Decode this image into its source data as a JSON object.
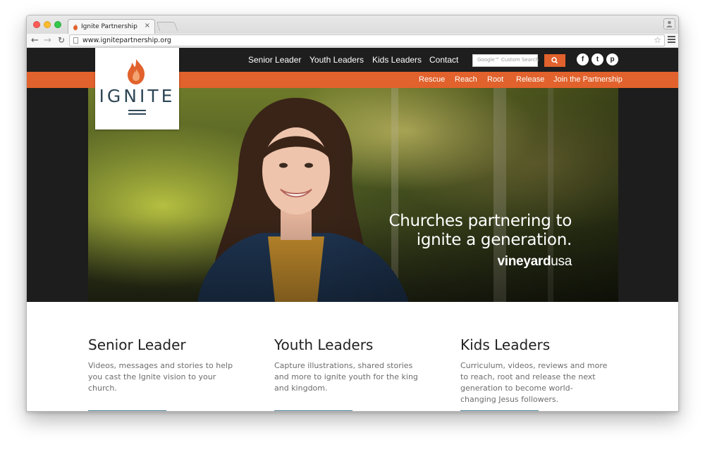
{
  "browser": {
    "tab_title": "Ignite Partnership",
    "tab_close": "×",
    "url": "www.ignitepartnership.org"
  },
  "site": {
    "logo_text": "IGNITE",
    "main_nav": [
      "Senior Leader",
      "Youth Leaders",
      "Kids Leaders",
      "Contact"
    ],
    "search_placeholder": "Google™ Custom Search",
    "social": [
      "f",
      "t",
      "p"
    ],
    "sub_nav": [
      "Rescue",
      "Reach",
      "Root",
      "Release",
      "Join the Partnership"
    ],
    "hero": {
      "headline_line1": "Churches partnering to",
      "headline_line2": "ignite a generation.",
      "brand_bold": "vineyard",
      "brand_light": "usa"
    },
    "columns": [
      {
        "title": "Senior Leader",
        "text": "Videos, messages and stories to help you cast the Ignite vision to your church."
      },
      {
        "title": "Youth Leaders",
        "text": "Capture illustrations, shared stories and more to ignite youth for the king and kingdom."
      },
      {
        "title": "Kids Leaders",
        "text": "Curriculum, videos, reviews and more to reach, root and release the next generation to become world-changing Jesus followers."
      }
    ]
  },
  "colors": {
    "accent": "#e1622c",
    "nav_bg": "#1e1e1e",
    "logo_text": "#2e4756",
    "button": "#4e7f98"
  },
  "icons": [
    "flame-icon",
    "back-icon",
    "forward-icon",
    "reload-icon",
    "page-icon",
    "star-icon",
    "menu-icon",
    "search-icon",
    "facebook-icon",
    "twitter-icon",
    "pinterest-icon",
    "profile-icon"
  ]
}
